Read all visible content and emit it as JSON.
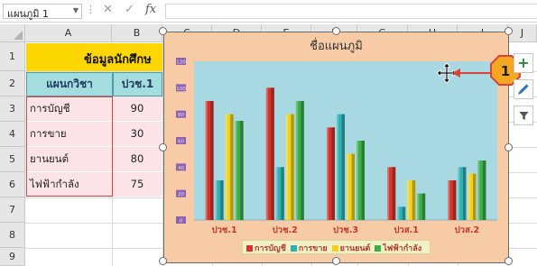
{
  "formula_bar": {
    "name_box": "แผนภูมิ 1",
    "formula": ""
  },
  "columns": [
    "A",
    "B",
    "C",
    "D",
    "E",
    "F",
    "G",
    "H",
    "I",
    "J"
  ],
  "rows": [
    "1",
    "2",
    "3",
    "4",
    "5",
    "6",
    "7",
    "8",
    "9"
  ],
  "sheet": {
    "title": "ข้อมูลนักศึกษ",
    "header_dept": "แผนกวิชา",
    "header_col_b": "ปวช.1",
    "table_rows": [
      {
        "name": "การบัญชี",
        "value": "90"
      },
      {
        "name": "การขาย",
        "value": "30"
      },
      {
        "name": "ยานยนต์",
        "value": "80"
      },
      {
        "name": "ไฟฟ้ากำลัง",
        "value": "75"
      }
    ]
  },
  "chart": {
    "title": "ชื่อแผนภูมิ",
    "y_tick_labels": [
      "120",
      "100",
      "80",
      "60",
      "40",
      "20",
      "0"
    ],
    "colors": {
      "chart_bg": "#f7cba6",
      "plot_bg": "#a8d9e3",
      "label_color": "#c0392b",
      "tick_bg": "#8b63b0"
    },
    "callout_number": "1",
    "icons": {
      "move": "move-cursor-icon",
      "add": "plus-icon",
      "style": "brush-icon",
      "filter": "filter-icon"
    }
  },
  "chart_data": {
    "type": "bar",
    "title": "ชื่อแผนภูมิ",
    "categories": [
      "ปวช.1",
      "ปวช.2",
      "ปวช.3",
      "ปวส.1",
      "ปวส.2"
    ],
    "ylim": [
      0,
      120
    ],
    "grid": false,
    "legend": "bottom",
    "series": [
      {
        "name": "การบัญชี",
        "color": "#d2352e",
        "values": [
          90,
          100,
          70,
          40,
          30
        ]
      },
      {
        "name": "การขาย",
        "color": "#2fb1b4",
        "values": [
          30,
          40,
          80,
          10,
          40
        ]
      },
      {
        "name": "ยานยนต์",
        "color": "#f1d21f",
        "values": [
          80,
          80,
          50,
          30,
          35
        ]
      },
      {
        "name": "ไฟฟ้ากำลัง",
        "color": "#3cae4a",
        "values": [
          75,
          90,
          60,
          20,
          45
        ]
      }
    ]
  }
}
